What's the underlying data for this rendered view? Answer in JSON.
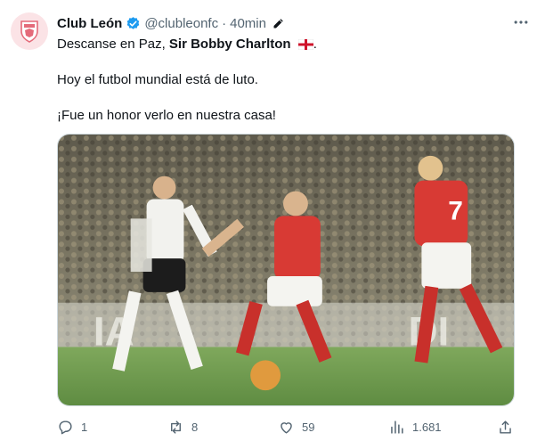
{
  "author": {
    "name": "Club León",
    "handle": "@clubleonfc",
    "separator": "·",
    "time": "40min"
  },
  "post": {
    "line1_prefix": "Descanse en Paz, ",
    "line1_bold": "Sir Bobby Charlton",
    "line1_suffix": ".",
    "line2": "Hoy el futbol mundial está de luto.",
    "line3": "¡Fue un honor verlo en nuestra casa!"
  },
  "media": {
    "shirt_number": "7",
    "colors": {
      "england_red": "#d83a34",
      "germany_white": "#f2f2ee",
      "pitch": "#6f9b4f"
    }
  },
  "actions": {
    "replies": "1",
    "reposts": "8",
    "likes": "59",
    "views": "1.681"
  },
  "colors": {
    "verified": "#1d9bf0",
    "muted": "#536471",
    "text": "#0f1419"
  }
}
